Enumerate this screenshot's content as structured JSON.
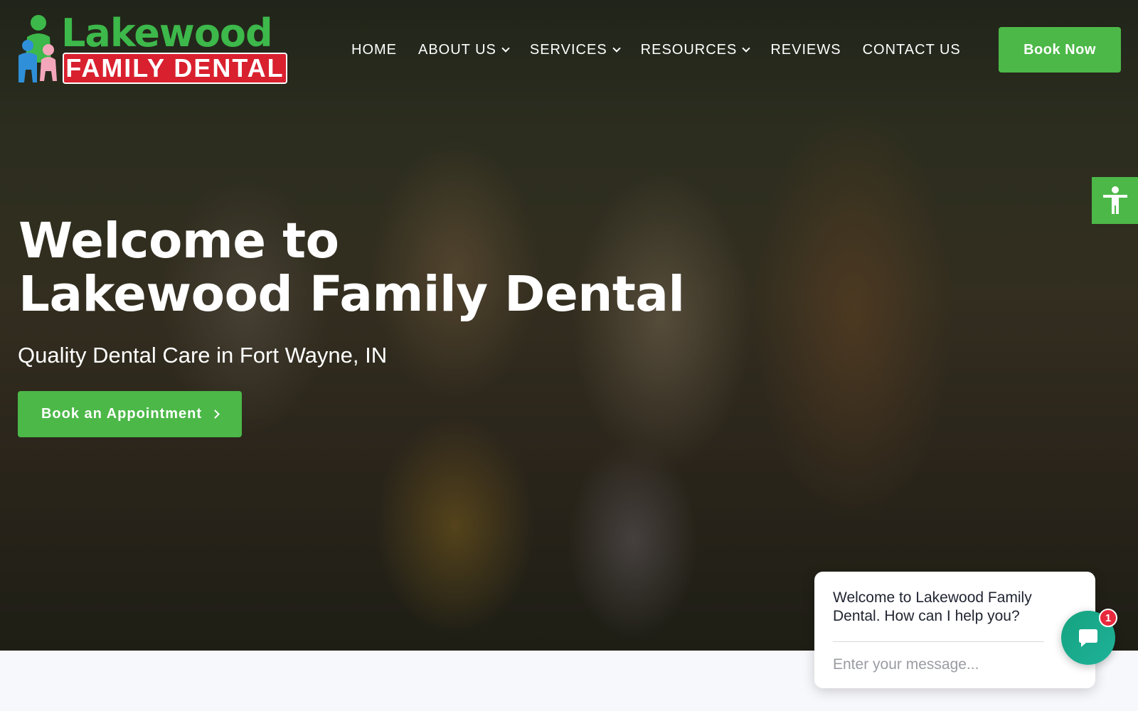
{
  "logo": {
    "top_text": "Lakewood",
    "bottom_text": "FAMILY DENTAL"
  },
  "nav": {
    "items": [
      {
        "label": "HOME",
        "has_dropdown": false
      },
      {
        "label": "ABOUT US",
        "has_dropdown": true
      },
      {
        "label": "SERVICES",
        "has_dropdown": true
      },
      {
        "label": "RESOURCES",
        "has_dropdown": true
      },
      {
        "label": "REVIEWS",
        "has_dropdown": false
      },
      {
        "label": "CONTACT US",
        "has_dropdown": false
      }
    ]
  },
  "header": {
    "book_now_label": "Book Now"
  },
  "hero": {
    "title_line1": "Welcome to",
    "title_line2": "Lakewood Family Dental",
    "subtitle": "Quality Dental Care in Fort Wayne, IN",
    "cta_label": "Book an Appointment"
  },
  "chat": {
    "message": "Welcome to Lakewood Family Dental. How can I help you?",
    "input_placeholder": "Enter your message...",
    "badge_count": "1"
  },
  "icons": {
    "accessibility": "accessibility-icon",
    "chat": "chat-bubble-icon",
    "chevron": "chevron-down-icon",
    "arrow": "chevron-right-icon"
  },
  "colors": {
    "brand_green": "#4cb848",
    "brand_red": "#d9202f",
    "chat_teal": "#15a37f",
    "badge_red": "#e8283c"
  }
}
